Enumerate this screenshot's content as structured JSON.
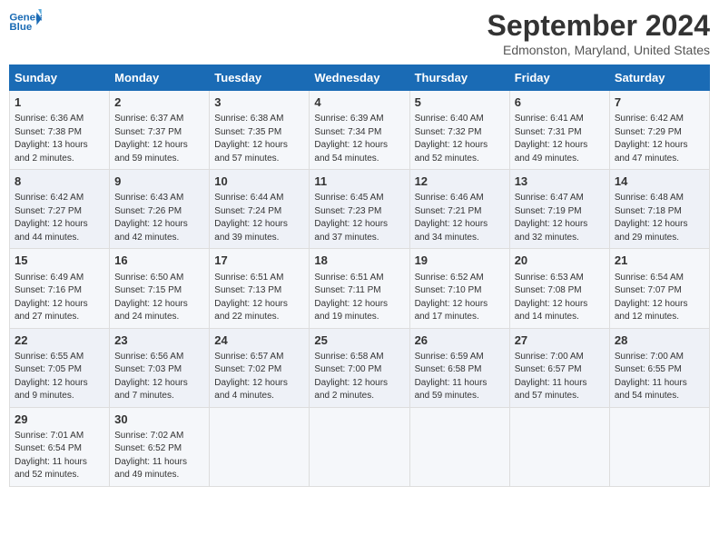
{
  "logo": {
    "line1": "General",
    "line2": "Blue"
  },
  "title": "September 2024",
  "subtitle": "Edmonston, Maryland, United States",
  "days_of_week": [
    "Sunday",
    "Monday",
    "Tuesday",
    "Wednesday",
    "Thursday",
    "Friday",
    "Saturday"
  ],
  "weeks": [
    [
      {
        "day": "1",
        "sunrise": "Sunrise: 6:36 AM",
        "sunset": "Sunset: 7:38 PM",
        "daylight": "Daylight: 13 hours and 2 minutes."
      },
      {
        "day": "2",
        "sunrise": "Sunrise: 6:37 AM",
        "sunset": "Sunset: 7:37 PM",
        "daylight": "Daylight: 12 hours and 59 minutes."
      },
      {
        "day": "3",
        "sunrise": "Sunrise: 6:38 AM",
        "sunset": "Sunset: 7:35 PM",
        "daylight": "Daylight: 12 hours and 57 minutes."
      },
      {
        "day": "4",
        "sunrise": "Sunrise: 6:39 AM",
        "sunset": "Sunset: 7:34 PM",
        "daylight": "Daylight: 12 hours and 54 minutes."
      },
      {
        "day": "5",
        "sunrise": "Sunrise: 6:40 AM",
        "sunset": "Sunset: 7:32 PM",
        "daylight": "Daylight: 12 hours and 52 minutes."
      },
      {
        "day": "6",
        "sunrise": "Sunrise: 6:41 AM",
        "sunset": "Sunset: 7:31 PM",
        "daylight": "Daylight: 12 hours and 49 minutes."
      },
      {
        "day": "7",
        "sunrise": "Sunrise: 6:42 AM",
        "sunset": "Sunset: 7:29 PM",
        "daylight": "Daylight: 12 hours and 47 minutes."
      }
    ],
    [
      {
        "day": "8",
        "sunrise": "Sunrise: 6:42 AM",
        "sunset": "Sunset: 7:27 PM",
        "daylight": "Daylight: 12 hours and 44 minutes."
      },
      {
        "day": "9",
        "sunrise": "Sunrise: 6:43 AM",
        "sunset": "Sunset: 7:26 PM",
        "daylight": "Daylight: 12 hours and 42 minutes."
      },
      {
        "day": "10",
        "sunrise": "Sunrise: 6:44 AM",
        "sunset": "Sunset: 7:24 PM",
        "daylight": "Daylight: 12 hours and 39 minutes."
      },
      {
        "day": "11",
        "sunrise": "Sunrise: 6:45 AM",
        "sunset": "Sunset: 7:23 PM",
        "daylight": "Daylight: 12 hours and 37 minutes."
      },
      {
        "day": "12",
        "sunrise": "Sunrise: 6:46 AM",
        "sunset": "Sunset: 7:21 PM",
        "daylight": "Daylight: 12 hours and 34 minutes."
      },
      {
        "day": "13",
        "sunrise": "Sunrise: 6:47 AM",
        "sunset": "Sunset: 7:19 PM",
        "daylight": "Daylight: 12 hours and 32 minutes."
      },
      {
        "day": "14",
        "sunrise": "Sunrise: 6:48 AM",
        "sunset": "Sunset: 7:18 PM",
        "daylight": "Daylight: 12 hours and 29 minutes."
      }
    ],
    [
      {
        "day": "15",
        "sunrise": "Sunrise: 6:49 AM",
        "sunset": "Sunset: 7:16 PM",
        "daylight": "Daylight: 12 hours and 27 minutes."
      },
      {
        "day": "16",
        "sunrise": "Sunrise: 6:50 AM",
        "sunset": "Sunset: 7:15 PM",
        "daylight": "Daylight: 12 hours and 24 minutes."
      },
      {
        "day": "17",
        "sunrise": "Sunrise: 6:51 AM",
        "sunset": "Sunset: 7:13 PM",
        "daylight": "Daylight: 12 hours and 22 minutes."
      },
      {
        "day": "18",
        "sunrise": "Sunrise: 6:51 AM",
        "sunset": "Sunset: 7:11 PM",
        "daylight": "Daylight: 12 hours and 19 minutes."
      },
      {
        "day": "19",
        "sunrise": "Sunrise: 6:52 AM",
        "sunset": "Sunset: 7:10 PM",
        "daylight": "Daylight: 12 hours and 17 minutes."
      },
      {
        "day": "20",
        "sunrise": "Sunrise: 6:53 AM",
        "sunset": "Sunset: 7:08 PM",
        "daylight": "Daylight: 12 hours and 14 minutes."
      },
      {
        "day": "21",
        "sunrise": "Sunrise: 6:54 AM",
        "sunset": "Sunset: 7:07 PM",
        "daylight": "Daylight: 12 hours and 12 minutes."
      }
    ],
    [
      {
        "day": "22",
        "sunrise": "Sunrise: 6:55 AM",
        "sunset": "Sunset: 7:05 PM",
        "daylight": "Daylight: 12 hours and 9 minutes."
      },
      {
        "day": "23",
        "sunrise": "Sunrise: 6:56 AM",
        "sunset": "Sunset: 7:03 PM",
        "daylight": "Daylight: 12 hours and 7 minutes."
      },
      {
        "day": "24",
        "sunrise": "Sunrise: 6:57 AM",
        "sunset": "Sunset: 7:02 PM",
        "daylight": "Daylight: 12 hours and 4 minutes."
      },
      {
        "day": "25",
        "sunrise": "Sunrise: 6:58 AM",
        "sunset": "Sunset: 7:00 PM",
        "daylight": "Daylight: 12 hours and 2 minutes."
      },
      {
        "day": "26",
        "sunrise": "Sunrise: 6:59 AM",
        "sunset": "Sunset: 6:58 PM",
        "daylight": "Daylight: 11 hours and 59 minutes."
      },
      {
        "day": "27",
        "sunrise": "Sunrise: 7:00 AM",
        "sunset": "Sunset: 6:57 PM",
        "daylight": "Daylight: 11 hours and 57 minutes."
      },
      {
        "day": "28",
        "sunrise": "Sunrise: 7:00 AM",
        "sunset": "Sunset: 6:55 PM",
        "daylight": "Daylight: 11 hours and 54 minutes."
      }
    ],
    [
      {
        "day": "29",
        "sunrise": "Sunrise: 7:01 AM",
        "sunset": "Sunset: 6:54 PM",
        "daylight": "Daylight: 11 hours and 52 minutes."
      },
      {
        "day": "30",
        "sunrise": "Sunrise: 7:02 AM",
        "sunset": "Sunset: 6:52 PM",
        "daylight": "Daylight: 11 hours and 49 minutes."
      },
      null,
      null,
      null,
      null,
      null
    ]
  ]
}
